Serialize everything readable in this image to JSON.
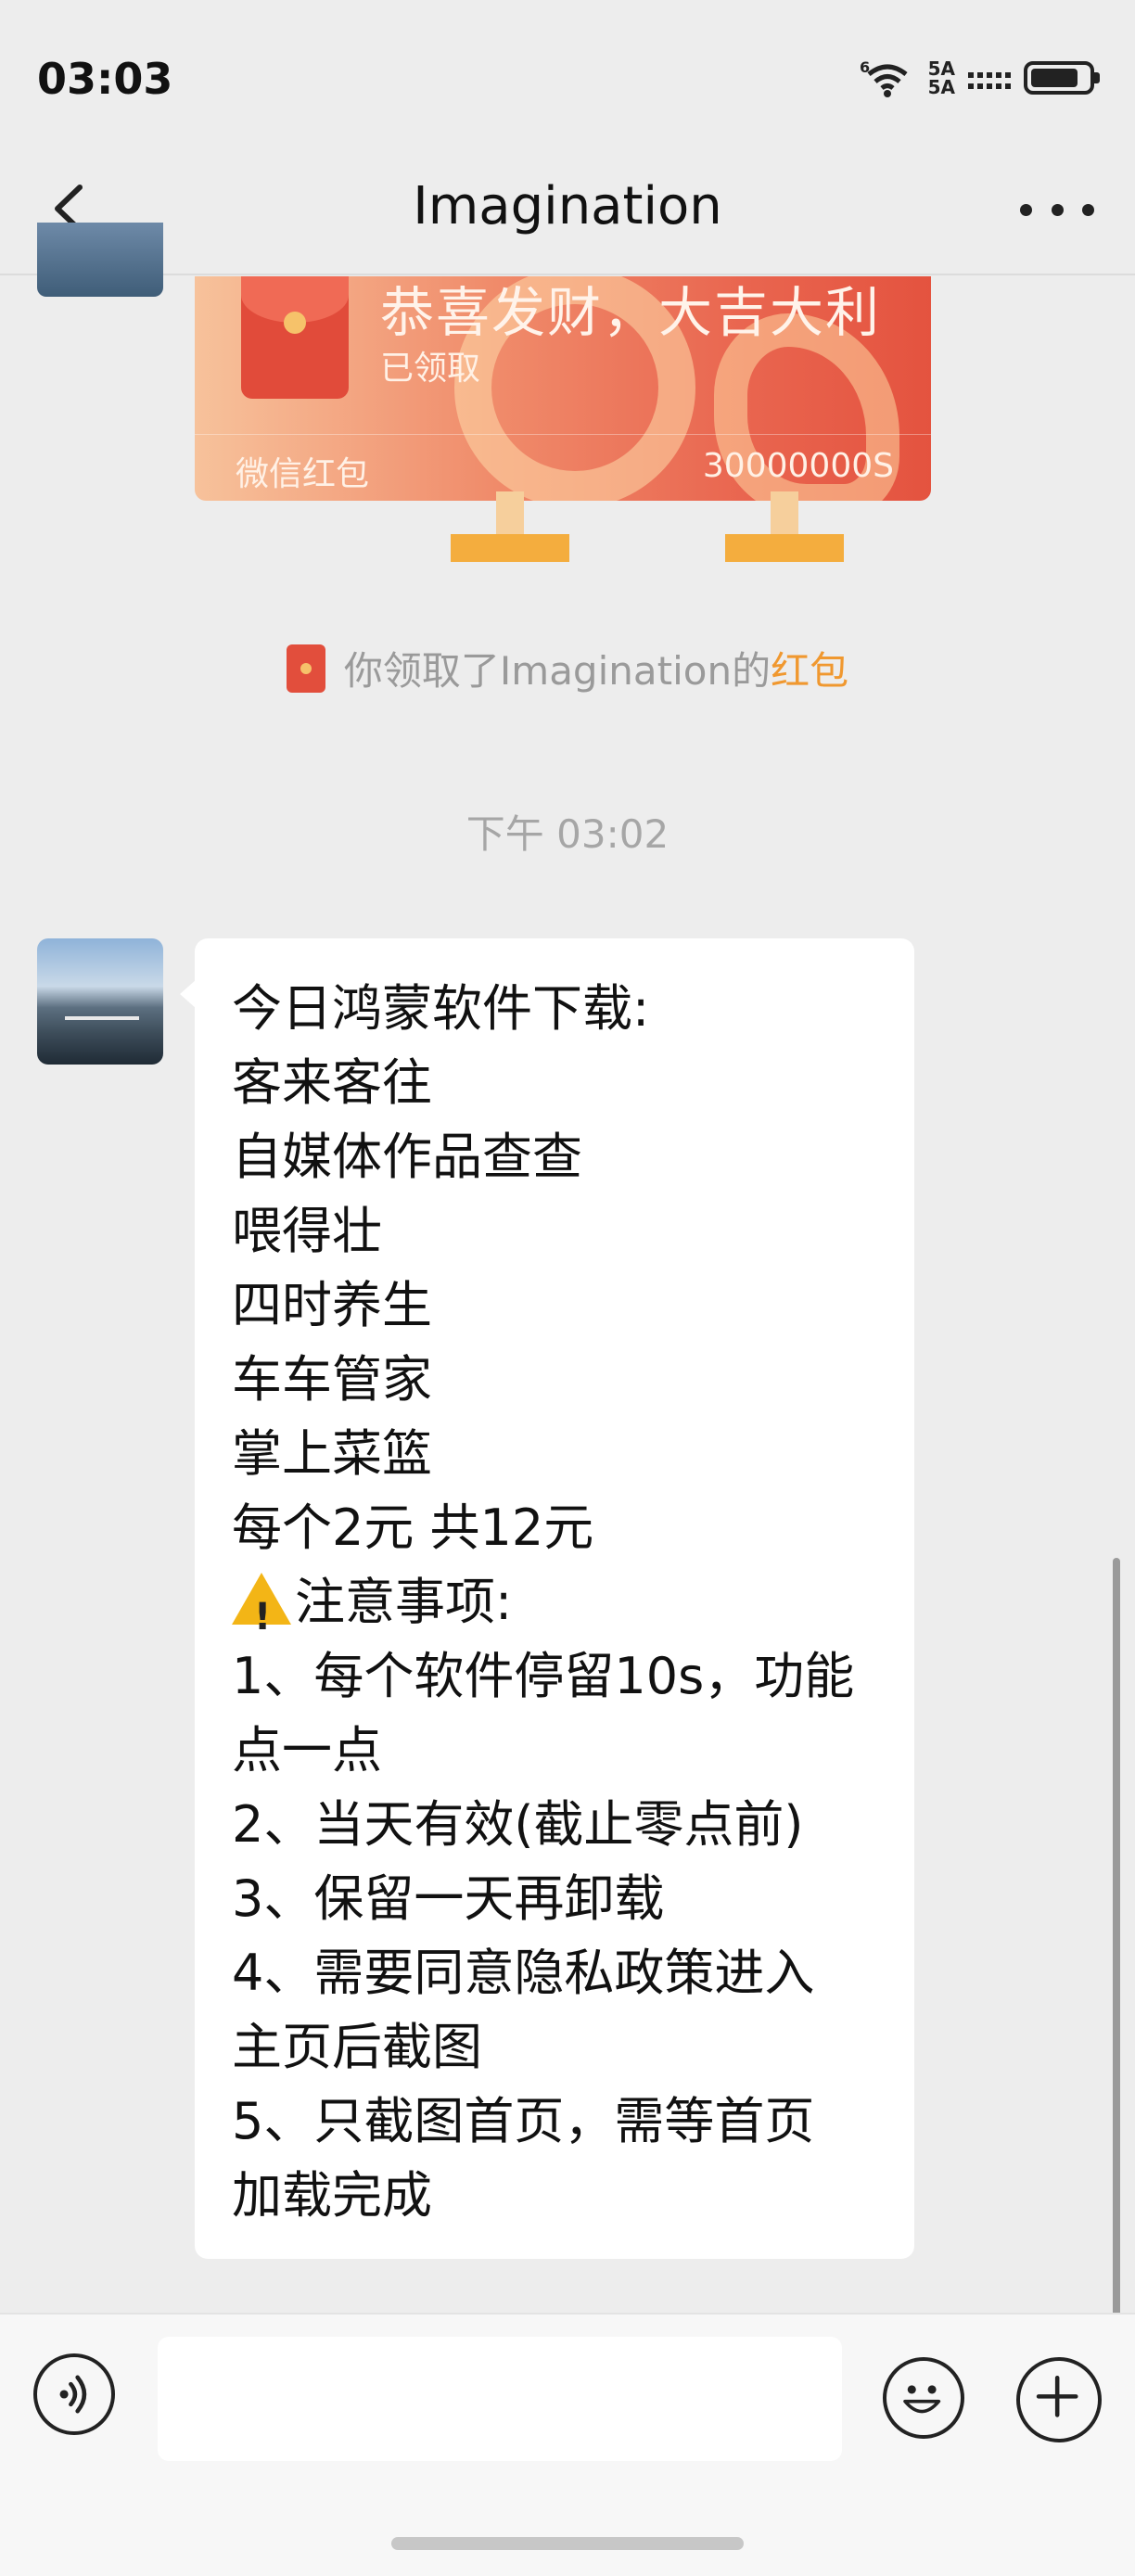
{
  "status_bar": {
    "time": "03:03",
    "network": "6",
    "signal_1": "5A",
    "signal_2": "5A",
    "battery_level": 0.85
  },
  "nav": {
    "title": "Imagination",
    "back_icon": "chevron-left-icon",
    "more_icon": "more-dots-icon"
  },
  "red_packet": {
    "title": "恭喜发财，大吉大利",
    "status": "已领取",
    "label": "微信红包",
    "amount": "30000000S"
  },
  "notice": {
    "text": "你领取了Imagination的",
    "link": "红包"
  },
  "timestamp": "下午 03:02",
  "message": {
    "lines": [
      "今日鸿蒙软件下载:",
      "客来客往",
      "自媒体作品查查",
      "喂得壮",
      "四时养生",
      "车车管家",
      "掌上菜篮",
      "每个2元 共12元",
      "注意事项:",
      "1、每个软件停留10s，功能",
      "点一点",
      "2、当天有效(截止零点前)",
      "3、保留一天再卸载",
      "4、需要同意隐私政策进入",
      "主页后截图",
      "5、只截图首页，需等首页",
      "加载完成"
    ],
    "warning_icon": "warning-icon"
  },
  "input_bar": {
    "placeholder": "",
    "voice_icon": "voice-icon",
    "emoji_icon": "emoji-icon",
    "plus_icon": "plus-icon"
  }
}
